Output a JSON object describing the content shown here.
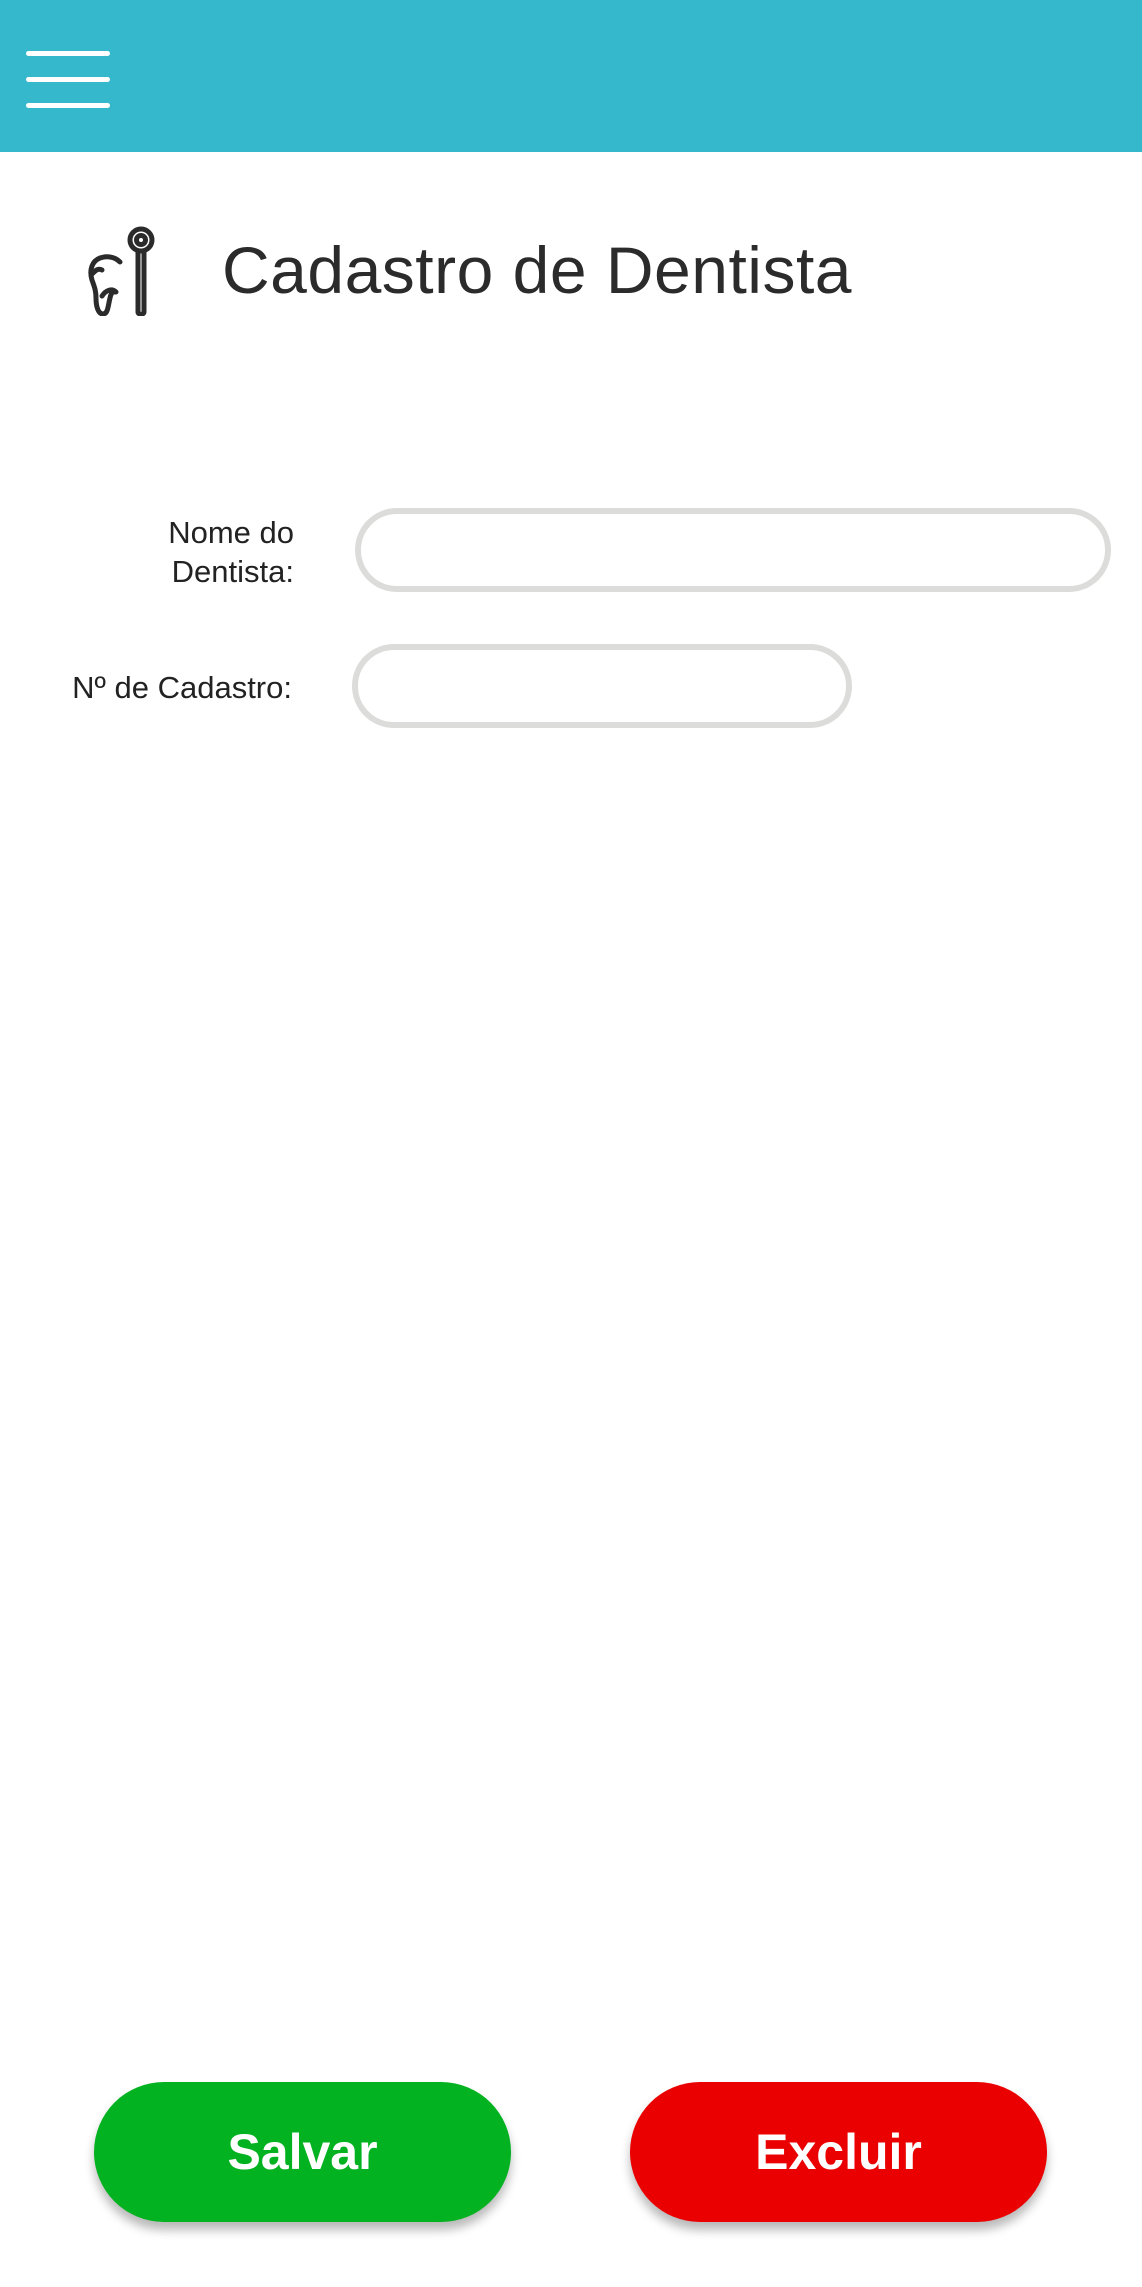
{
  "header": {
    "menu_icon": "hamburger-menu-icon",
    "bar_color": "#36b8cc"
  },
  "page": {
    "title": "Cadastro de Dentista",
    "title_icon": "tooth-dentist-icon"
  },
  "form": {
    "dentist_name_label": "Nome do Dentista:",
    "dentist_name_value": "",
    "registration_label": "Nº de Cadastro:",
    "registration_value": ""
  },
  "actions": {
    "save_label": "Salvar",
    "save_color": "#02b220",
    "delete_label": "Excluir",
    "delete_color": "#ea0000"
  }
}
